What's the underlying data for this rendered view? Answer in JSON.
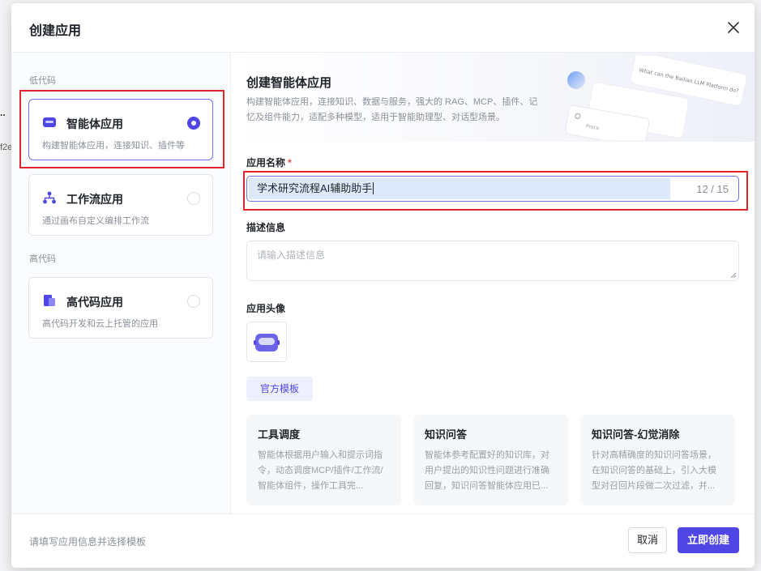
{
  "dialog": {
    "title": "创建应用",
    "close_icon": "close-icon"
  },
  "left": {
    "groups": [
      {
        "label": "低代码"
      },
      {
        "label": "高代码"
      }
    ],
    "cards": [
      {
        "title": "智能体应用",
        "desc": "构建智能体应用，连接知识、插件等",
        "icon": "agent-app-icon",
        "selected": true
      },
      {
        "title": "工作流应用",
        "desc": "通过画布自定义编排工作流",
        "icon": "workflow-icon",
        "selected": false
      },
      {
        "title": "高代码应用",
        "desc": "高代码开发和云上托管的应用",
        "icon": "high-code-icon",
        "selected": false
      }
    ]
  },
  "hero": {
    "title": "创建智能体应用",
    "desc": "构建智能体应用，连接知识、数据与服务，强大的 RAG、MCP、插件、记忆及组件能力，适配多种模型，适用于智能助理型、对话型场景。",
    "art_text": "What can the Bailian LLM Platform do?",
    "art_text2": "Proce"
  },
  "form": {
    "name_label": "应用名称",
    "required_mark": "*",
    "name_value": "学术研究流程AI辅助助手",
    "name_count": "12 / 15",
    "desc_label": "描述信息",
    "desc_placeholder": "请输入描述信息",
    "avatar_label": "应用头像"
  },
  "templates": {
    "tab_label": "官方模板",
    "cards": [
      {
        "title": "工具调度",
        "desc": "智能体根据用户输入和提示词指令，动态调度MCP/插件/工作流/智能体组件，操作工具完..."
      },
      {
        "title": "知识问答",
        "desc": "智能体参考配置好的知识库，对用户提出的知识性问题进行准确回复，知识问答智能体应用已..."
      },
      {
        "title": "知识问答-幻觉消除",
        "desc": "针对高精确度的知识问答场景，在知识问答的基础上，引入大模型对召回片段做二次过滤，并..."
      }
    ]
  },
  "footer": {
    "hint": "请填写应用信息并选择模板",
    "cancel_label": "取消",
    "create_label": "立即创建"
  },
  "background": {
    "edge_text_1": "..",
    "edge_text_2": "f2e"
  },
  "colors": {
    "accent": "#4f46e5",
    "highlight": "#e0242c",
    "selected_border": "#6b74e6"
  }
}
